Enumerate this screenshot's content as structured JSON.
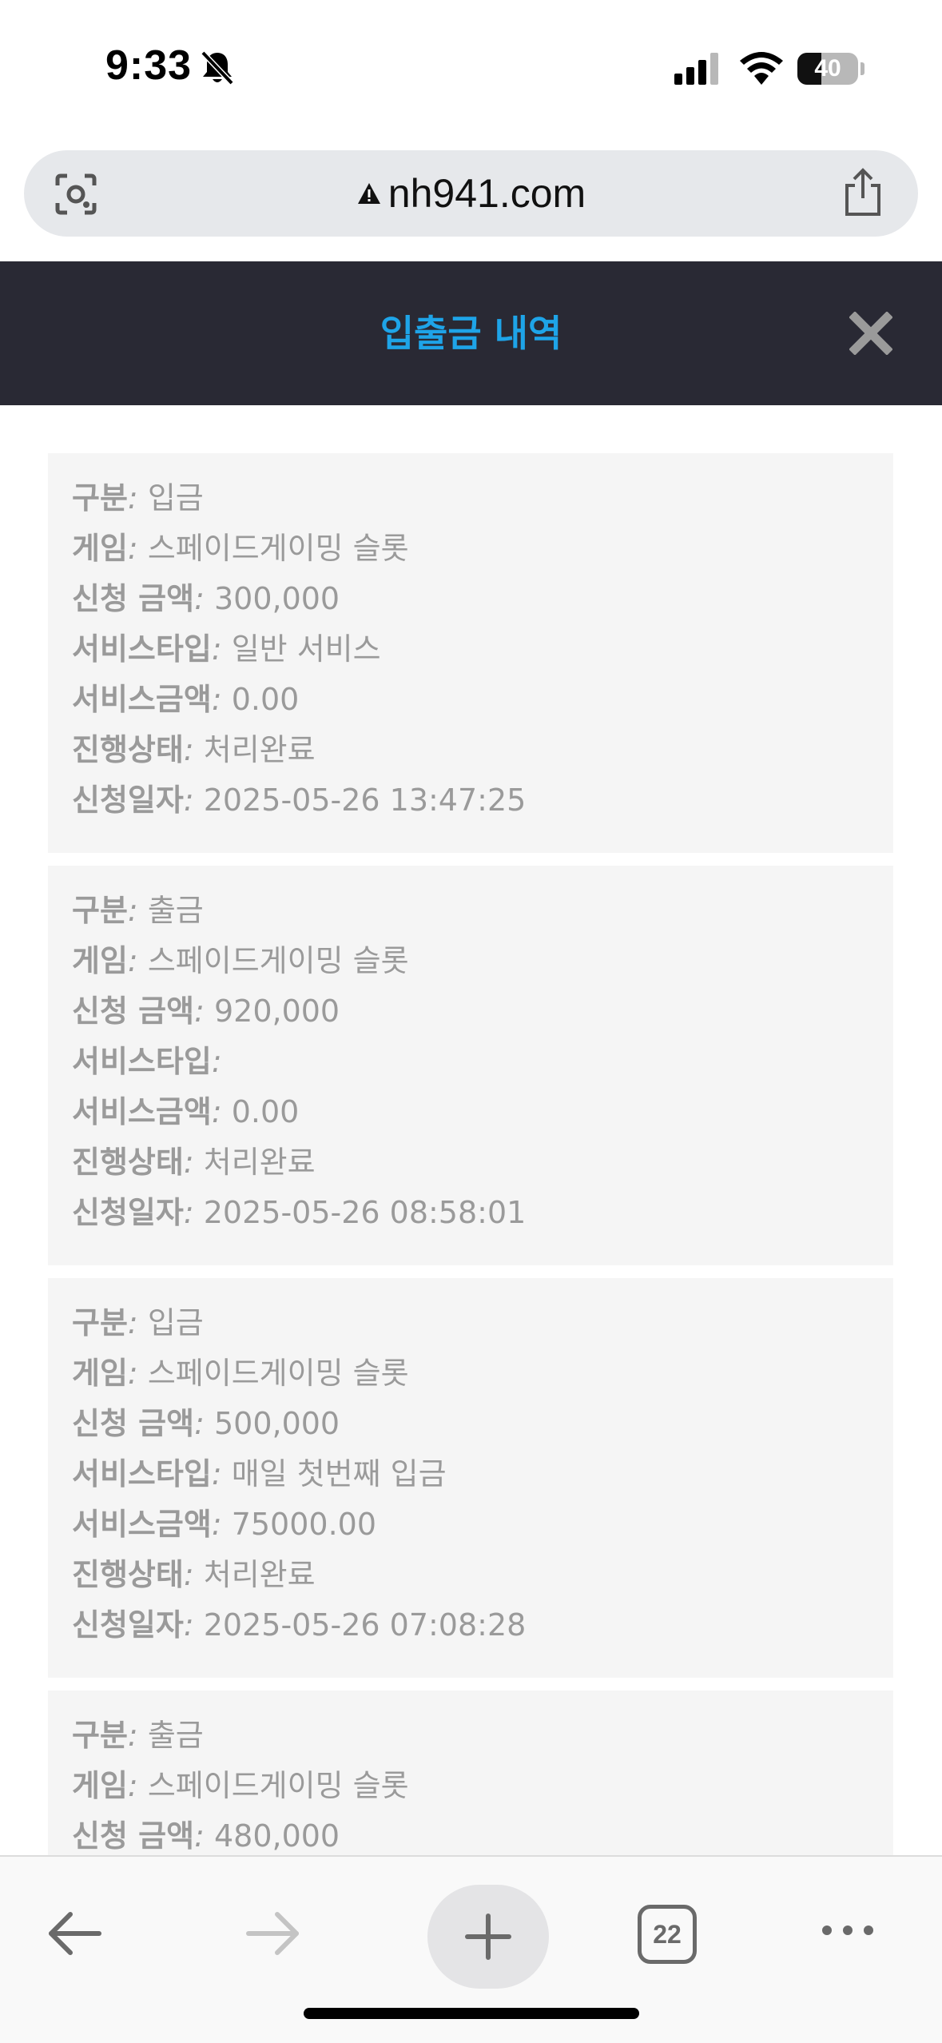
{
  "status_bar": {
    "time": "9:33",
    "battery_level": "40",
    "battery_fraction": 0.4
  },
  "browser": {
    "url": "nh941.com",
    "tab_count": "22"
  },
  "page": {
    "title": "입출금 내역"
  },
  "colors": {
    "header_bg": "#292934",
    "title_accent": "#1ea4e8",
    "card_bg": "#f5f5f5",
    "text_gray": "#9a9a9a"
  },
  "icons": [
    "bell-slash-icon",
    "signal-icon",
    "wifi-icon",
    "battery-icon",
    "lens-icon",
    "warning-icon",
    "share-icon",
    "close-icon",
    "back-arrow-icon",
    "forward-arrow-icon",
    "plus-icon",
    "more-icon"
  ],
  "records": [
    {
      "fields": [
        {
          "label": "구분",
          "value": "입금"
        },
        {
          "label": "게임",
          "value": "스페이드게이밍 슬롯"
        },
        {
          "label": "신청 금액",
          "value": "300,000"
        },
        {
          "label": "서비스타입",
          "value": "일반 서비스"
        },
        {
          "label": "서비스금액",
          "value": "0.00"
        },
        {
          "label": "진행상태",
          "value": "처리완료"
        },
        {
          "label": "신청일자",
          "value": "2025-05-26 13:47:25"
        }
      ]
    },
    {
      "fields": [
        {
          "label": "구분",
          "value": "출금"
        },
        {
          "label": "게임",
          "value": "스페이드게이밍 슬롯"
        },
        {
          "label": "신청 금액",
          "value": "920,000"
        },
        {
          "label": "서비스타입",
          "value": ""
        },
        {
          "label": "서비스금액",
          "value": "0.00"
        },
        {
          "label": "진행상태",
          "value": "처리완료"
        },
        {
          "label": "신청일자",
          "value": "2025-05-26 08:58:01"
        }
      ]
    },
    {
      "fields": [
        {
          "label": "구분",
          "value": "입금"
        },
        {
          "label": "게임",
          "value": "스페이드게이밍 슬롯"
        },
        {
          "label": "신청 금액",
          "value": "500,000"
        },
        {
          "label": "서비스타입",
          "value": "매일 첫번째 입금"
        },
        {
          "label": "서비스금액",
          "value": "75000.00"
        },
        {
          "label": "진행상태",
          "value": "처리완료"
        },
        {
          "label": "신청일자",
          "value": "2025-05-26 07:08:28"
        }
      ]
    },
    {
      "fields": [
        {
          "label": "구분",
          "value": "출금"
        },
        {
          "label": "게임",
          "value": "스페이드게이밍 슬롯"
        },
        {
          "label": "신청 금액",
          "value": "480,000"
        }
      ]
    }
  ]
}
